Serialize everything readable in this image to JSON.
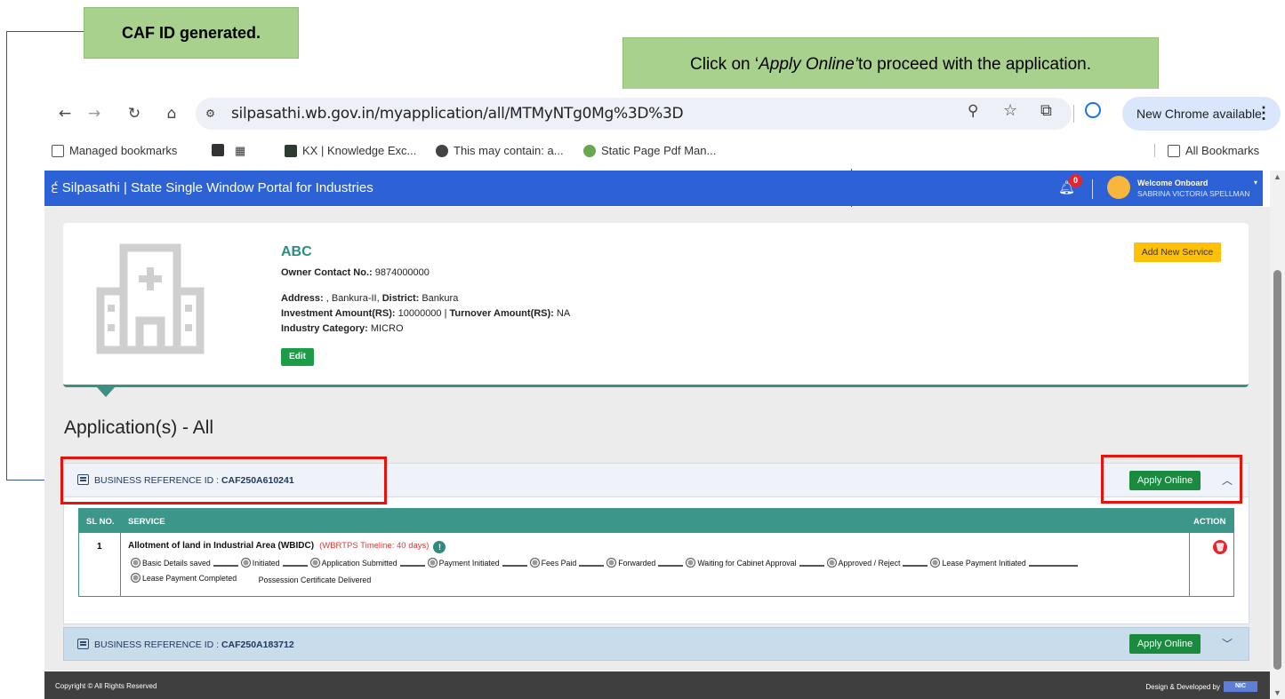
{
  "callouts": {
    "caf_generated": "CAF ID generated.",
    "apply_prefix": "Click on ‘",
    "apply_italic": "Apply Online’",
    "apply_suffix": " to proceed with the application."
  },
  "browser": {
    "url": "silpasathi.wb.gov.in/myapplication/all/MTMyNTg0Mg%3D%3D",
    "new_chrome": "New Chrome available",
    "bookmarks": [
      "Managed bookmarks",
      "KX | Knowledge Exc...",
      "This may contain: a...",
      "Static Page Pdf Man..."
    ],
    "all_bookmarks": "All Bookmarks"
  },
  "app": {
    "title": "੬ Silpasathi | State Single Window Portal for Industries",
    "notification_count": "0",
    "welcome": "Welcome Onboard",
    "user_name": "SABRINA VICTORIA SPELLMAN"
  },
  "profile": {
    "company": "ABC",
    "owner_contact_label": "Owner Contact No.:",
    "owner_contact": " 9874000000",
    "address_label": "Address:",
    "address": " , Bankura-II, ",
    "district_label": "District:",
    "district": " Bankura",
    "investment_label": "Investment Amount(RS):",
    "investment": " 10000000 | ",
    "turnover_label": "Turnover Amount(RS):",
    "turnover": " NA",
    "category_label": "Industry Category:",
    "category": " MICRO",
    "edit_label": "Edit",
    "add_service_label": "Add New Service"
  },
  "applications": {
    "title": "Application(s) - All",
    "apply_label": "Apply Online",
    "ref_prefix": "BUSINESS REFERENCE ID : ",
    "ref1": "CAF250A610241",
    "ref2": "CAF250A183712",
    "table": {
      "col_sl": "SL NO.",
      "col_service": "SERVICE",
      "col_action": "ACTION",
      "row": {
        "sl": "1",
        "service": "Allotment of land in Industrial Area (WBIDC)",
        "timeline": "(WBRTPS Timeline: 40 days)",
        "steps": [
          "Basic Details saved",
          "Initiated",
          "Application Submitted",
          "Payment Initiated",
          "Fees Paid",
          "Forwarded",
          "Waiting for Cabinet Approval",
          "Approved / Reject",
          "Lease Payment Initiated"
        ],
        "steps_line2": [
          "Lease Payment Completed",
          "Possession Certificate Delivered"
        ]
      }
    }
  },
  "footer": {
    "copyright": "Copyright © All Rights Reserved",
    "designed_by": "Design & Developed by",
    "nic": "NIC"
  }
}
